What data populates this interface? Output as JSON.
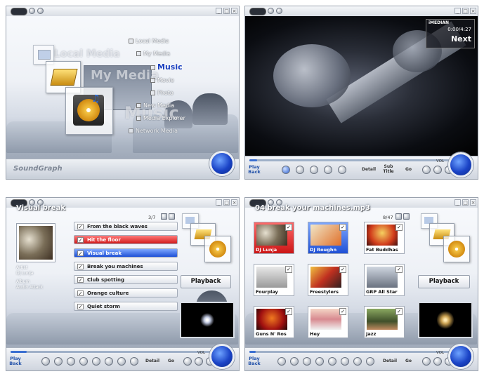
{
  "brand": "SoundGraph",
  "nav_menu": {
    "items": [
      "Local Media",
      "My Media",
      "Music",
      "Movie",
      "Photo",
      "New Media",
      "Media Explorer",
      "Network Media"
    ],
    "selected": "Music",
    "ghost_labels": [
      "Local Media",
      "My Media",
      "Music"
    ]
  },
  "video_player": {
    "header_logo": "iMEDIAN",
    "time": "0:00/4:27",
    "next_label": "Next",
    "controls": {
      "play_back": "Play Back",
      "detail": "Detail",
      "subtitle": "Sub Title",
      "go": "Go",
      "vol": "VOL"
    }
  },
  "music_player": {
    "title": "Visual break",
    "counter": "3/7",
    "artist_label": "Artist",
    "artist_value": "DJ Lunja",
    "album_label": "Album",
    "album_value": "Audio Attack",
    "tracks": [
      "From the black waves",
      "Hit the floor",
      "Visual break",
      "Break you machines",
      "Club spotting",
      "Orange culture",
      "Quiet storm"
    ],
    "playback_label": "Playback",
    "controls": {
      "play_back": "Play Back",
      "detail": "Detail",
      "go": "Go",
      "vol": "VOL"
    }
  },
  "album_grid": {
    "title": "04 break your machines.mp3",
    "counter": "8/47",
    "albums": [
      "DJ Lunja",
      "DJ Roughn",
      "Fat Buddhas",
      "Fourplay",
      "Freestylers",
      "GRP All Star",
      "Guns N' Ros",
      "Hey",
      "Jazz"
    ],
    "playback_label": "Playback",
    "controls": {
      "play_back": "Play Back",
      "detail": "Detail",
      "go": "Go",
      "vol": "VOL"
    }
  },
  "window_buttons": {
    "minimize": "_",
    "restore": "□",
    "close": "×"
  },
  "colors": {
    "accent_blue": "#1e50d6",
    "accent_red": "#d11a1a",
    "knob_blue": "#1a43c6"
  }
}
